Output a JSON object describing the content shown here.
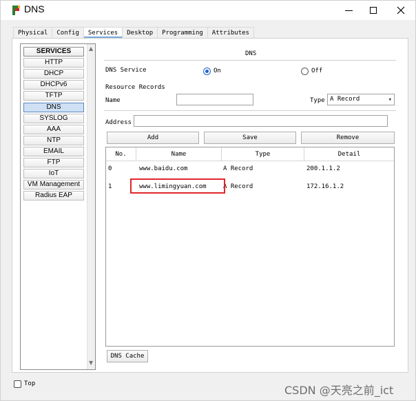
{
  "window": {
    "title": "DNS",
    "icon": "packet-tracer-icon"
  },
  "tabs": [
    {
      "label": "Physical",
      "active": false
    },
    {
      "label": "Config",
      "active": false
    },
    {
      "label": "Services",
      "active": true
    },
    {
      "label": "Desktop",
      "active": false
    },
    {
      "label": "Programming",
      "active": false
    },
    {
      "label": "Attributes",
      "active": false
    }
  ],
  "services": {
    "header": "SERVICES",
    "items": [
      "HTTP",
      "DHCP",
      "DHCPv6",
      "TFTP",
      "DNS",
      "SYSLOG",
      "AAA",
      "NTP",
      "EMAIL",
      "FTP",
      "IoT",
      "VM Management",
      "Radius EAP"
    ],
    "selected": "DNS"
  },
  "dns": {
    "section_title": "DNS",
    "service_label": "DNS Service",
    "on_label": "On",
    "off_label": "Off",
    "service_state": "On",
    "resource_records_label": "Resource Records",
    "name_label": "Name",
    "name_value": "",
    "type_label": "Type",
    "type_value": "A Record",
    "address_label": "Address",
    "address_value": "",
    "add_button": "Add",
    "save_button": "Save",
    "remove_button": "Remove",
    "table": {
      "headers": [
        "No.",
        "Name",
        "Type",
        "Detail"
      ],
      "rows": [
        {
          "no": "0",
          "name": "www.baidu.com",
          "type": "A Record",
          "detail": "200.1.1.2"
        },
        {
          "no": "1",
          "name": "www.limingyuan.com",
          "type": "A Record",
          "detail": "172.16.1.2"
        }
      ]
    },
    "cache_button": "DNS Cache"
  },
  "footer": {
    "top_label": "Top",
    "top_checked": false
  },
  "watermark": "CSDN @天亮之前_ict",
  "colors": {
    "highlight": "#e0262b",
    "selected_tab_underline": "#7aa7d9",
    "radio_selected": "#1e63c8"
  }
}
